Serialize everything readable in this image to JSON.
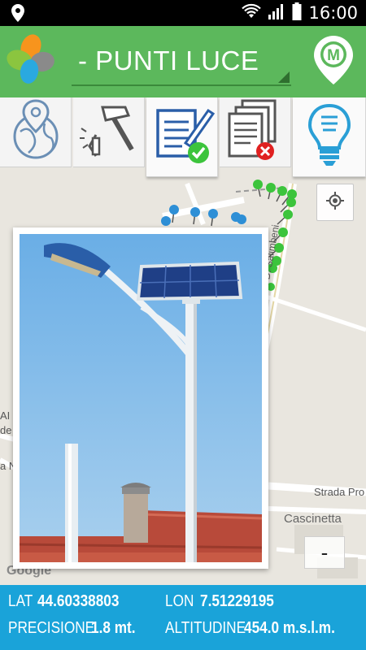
{
  "status_bar": {
    "time": "16:00",
    "icons": [
      "location-icon",
      "wifi-icon",
      "signal-icon",
      "battery-icon"
    ]
  },
  "header": {
    "title": "- PUNTI LUCE",
    "logo_icon": "app-logo-icon",
    "map_button_icon": "map-pin-m-icon",
    "map_button_letter": "M"
  },
  "toolbar": {
    "items": [
      {
        "icon": "globe-pin-icon"
      },
      {
        "icon": "hammer-icon"
      },
      {
        "icon": "document-check-icon"
      },
      {
        "icon": "documents-delete-icon"
      },
      {
        "icon": "lightbulb-icon"
      }
    ]
  },
  "map": {
    "labels": {
      "street_vertical": "V. D. Salimbeni",
      "strada": "Strada Pro",
      "cascinetta": "Cascinetta",
      "left_a": "AI",
      "left_b": "de",
      "left_c": "a N",
      "google": "Google"
    },
    "zoom_out_label": "-",
    "locate_icon": "my-location-icon"
  },
  "info": {
    "lat_label": "LAT",
    "lat_value": "44.60338803",
    "lon_label": "LON",
    "lon_value": "7.51229195",
    "precision_label": "PRECISIONE",
    "precision_value": "1.8 mt.",
    "altitude_label": "ALTITUDINE",
    "altitude_value": "454.0 m.s.l.m."
  },
  "colors": {
    "header_green": "#5cb85c",
    "info_blue": "#1aa3d9",
    "marker_green": "#3cc43c",
    "marker_blue": "#2e8fd6",
    "icon_blue": "#2a9fd6"
  }
}
